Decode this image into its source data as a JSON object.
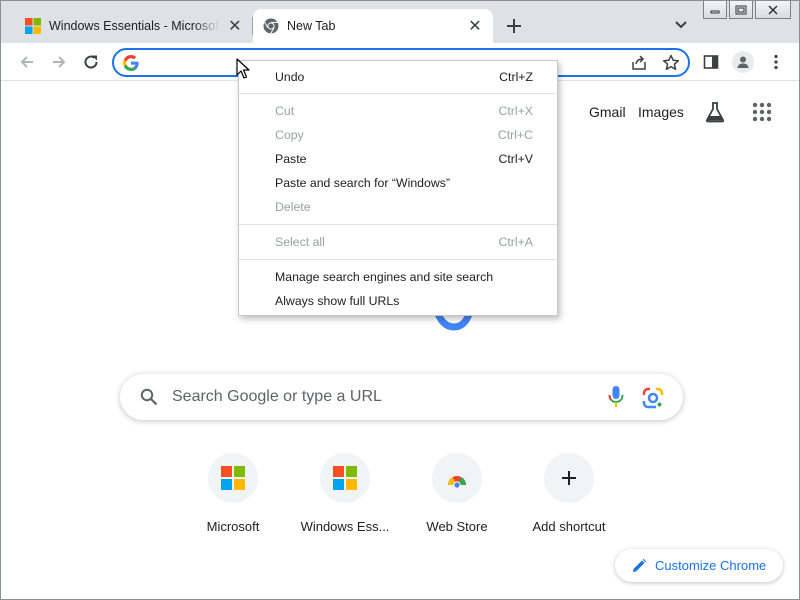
{
  "tabs": [
    {
      "title": "Windows Essentials - Microsoft Store",
      "favicon": "microsoft-logo-icon",
      "active": false
    },
    {
      "title": "New Tab",
      "favicon": "chrome-icon",
      "active": true
    }
  ],
  "omnibox": {
    "value": "",
    "placeholder": ""
  },
  "ntp": {
    "links": {
      "gmail": "Gmail",
      "images": "Images"
    },
    "search_placeholder": "Search Google or type a URL",
    "shortcuts": [
      {
        "label": "Microsoft",
        "icon": "microsoft-logo-icon"
      },
      {
        "label": "Windows Ess...",
        "icon": "microsoft-logo-icon"
      },
      {
        "label": "Web Store",
        "icon": "web-store-icon"
      },
      {
        "label": "Add shortcut",
        "icon": "plus-icon"
      }
    ],
    "customize_label": "Customize Chrome"
  },
  "context_menu": {
    "items": [
      {
        "label": "Undo",
        "shortcut": "Ctrl+Z",
        "enabled": true
      },
      {
        "label": "Cut",
        "shortcut": "Ctrl+X",
        "enabled": false
      },
      {
        "label": "Copy",
        "shortcut": "Ctrl+C",
        "enabled": false
      },
      {
        "label": "Paste",
        "shortcut": "Ctrl+V",
        "enabled": true
      },
      {
        "label": "Paste and search for “Windows”",
        "shortcut": "",
        "enabled": true
      },
      {
        "label": "Delete",
        "shortcut": "",
        "enabled": false
      },
      {
        "label": "Select all",
        "shortcut": "Ctrl+A",
        "enabled": false
      },
      {
        "label": "Manage search engines and site search",
        "shortcut": "",
        "enabled": true
      },
      {
        "label": "Always show full URLs",
        "shortcut": "",
        "enabled": true
      }
    ]
  },
  "colors": {
    "accent": "#1a73e8",
    "tabstrip": "#dee1e6",
    "disabled_text": "#9aa0a6"
  }
}
